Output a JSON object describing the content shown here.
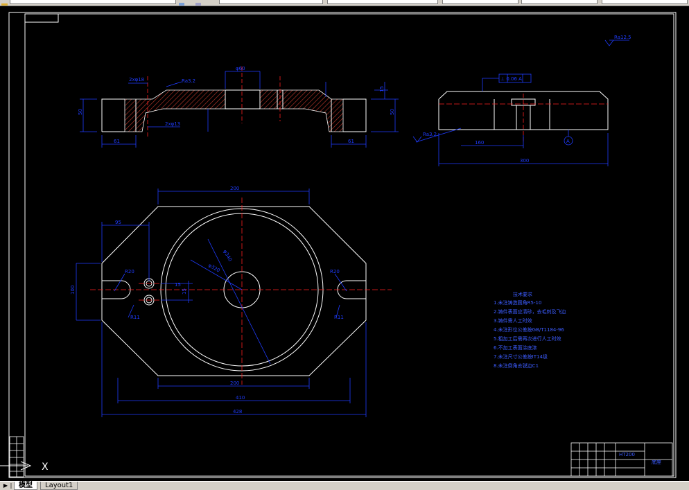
{
  "toolbar": {
    "fields": [
      "",
      "",
      "",
      "",
      "",
      ""
    ]
  },
  "drawing": {
    "colors": {
      "outline": "#ffffff",
      "dimension": "#1f3cff",
      "centerline": "#ff2020",
      "hatch": "#c0392b",
      "border": "#ffffff"
    },
    "dimensions": {
      "front_left_width": "61",
      "front_right_width": "61",
      "front_left_height": "50",
      "front_right_height": "50",
      "front_step_height": "15",
      "bore_label": "2xφ18",
      "bore_label_lower": "2xφ13",
      "center_bore": "φ60",
      "roughness_top": "Ra3.2",
      "side_total": "300",
      "side_inner": "160",
      "tolerance_frame": "⊥ 0.06 A",
      "datum": "A",
      "plan_top_width": "200",
      "plan_bottom_inner": "200",
      "plan_mid_width": "410",
      "plan_total_width": "428",
      "plan_left_offset": "95",
      "plan_left_height": "100",
      "radius_left": "R11",
      "radius_right": "R11",
      "radius_left_2": "R20",
      "radius_right_2": "R20",
      "diameter_outer": "φ340",
      "diameter_inner": "φ320",
      "small_dim_1": "15",
      "small_dim_2": "15",
      "roughness_corner": "Ra12.5"
    },
    "tech_requirements": {
      "title": "技术要求",
      "items": [
        "1.未注铸造圆角R5-10",
        "2.铸件表面应清砂，去毛刺及飞边",
        "3.铸件需人工时效",
        "4.未注形位公差按GB/T1184-96",
        "5.粗加工后需再次进行人工时效",
        "6.不加工表面涂底漆",
        "7.未注尺寸公差按IT14级",
        "8.未注倒角去锐边C1"
      ]
    },
    "title_block": {
      "part_name": "底座",
      "material": "HT200"
    }
  },
  "tabs": {
    "model": "模型",
    "layout": "Layout1"
  },
  "crosshair": {
    "x_label": "X"
  }
}
